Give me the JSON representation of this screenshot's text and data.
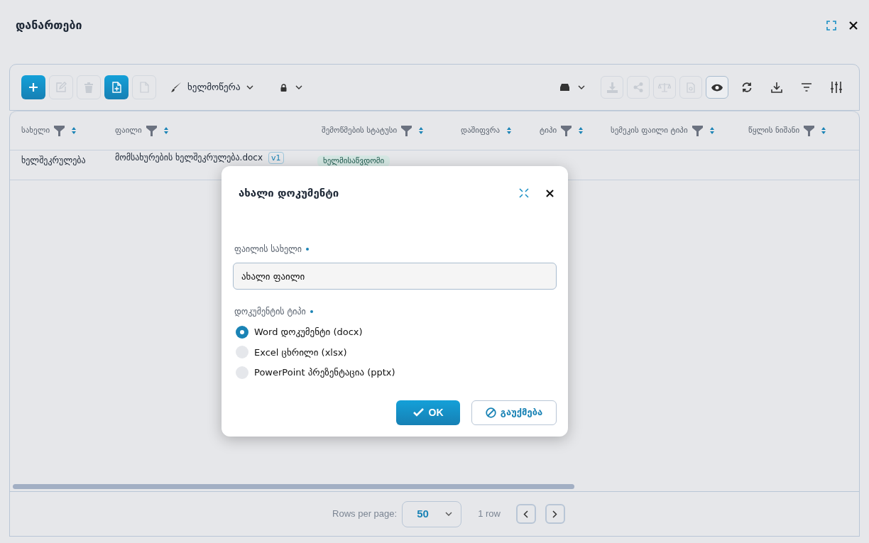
{
  "window": {
    "title": "დანართები"
  },
  "toolbar": {
    "left_buttons": [
      {
        "primary": true,
        "disabled": false
      },
      {
        "primary": false,
        "disabled": true
      },
      {
        "primary": false,
        "disabled": true
      },
      {
        "primary": true,
        "disabled": false
      },
      {
        "primary": false,
        "disabled": true
      }
    ],
    "signature_menu": {
      "label": "ხელმოწერა"
    },
    "right_buttons": [
      {
        "disabled": true,
        "active": false
      },
      {
        "disabled": true,
        "active": false
      },
      {
        "disabled": true,
        "active": false
      },
      {
        "disabled": true,
        "active": false
      },
      {
        "disabled": false,
        "active": true
      },
      {
        "disabled": false,
        "active": false
      },
      {
        "disabled": false,
        "active": false
      },
      {
        "disabled": false,
        "active": false
      },
      {
        "disabled": false,
        "active": false
      }
    ]
  },
  "table": {
    "columns": [
      {
        "label": "სახელი",
        "filterable": true
      },
      {
        "label": "ფაილი",
        "filterable": true
      },
      {
        "label": "შემოწმების სტატუსი",
        "filterable": true
      },
      {
        "label": "დაშიფვრა",
        "filterable": false
      },
      {
        "label": "ტიპი",
        "filterable": true
      },
      {
        "label": "სემეკის ფაილი ტიპი",
        "filterable": true
      },
      {
        "label": "წყლის ნიშანი",
        "filterable": true
      }
    ],
    "rows": [
      {
        "name": "ხელშეკრულება",
        "file": "მომსახურების ხელშეკრულება.docx",
        "version": "v1",
        "status": "ხელმისაწვდომი"
      }
    ]
  },
  "pagination": {
    "rows_per_page_label": "Rows per page:",
    "rows_per_page": "50",
    "count": "1 row"
  },
  "dialog": {
    "title": "ახალი დოკუმენტი",
    "file_name": {
      "label": "ფაილის სახელი",
      "required": true,
      "value": "ახალი ფაილი"
    },
    "document_type": {
      "label": "დოკუმენტის ტიპი",
      "required": true,
      "options": [
        {
          "label": "Word დოკუმენტი (docx)",
          "selected": true
        },
        {
          "label": "Excel ცხრილი (xlsx)",
          "selected": false
        },
        {
          "label": "PowerPoint პრეზენტაცია (pptx)",
          "selected": false
        }
      ]
    },
    "ok_button": "OK",
    "cancel_button": "გაუქმება"
  }
}
